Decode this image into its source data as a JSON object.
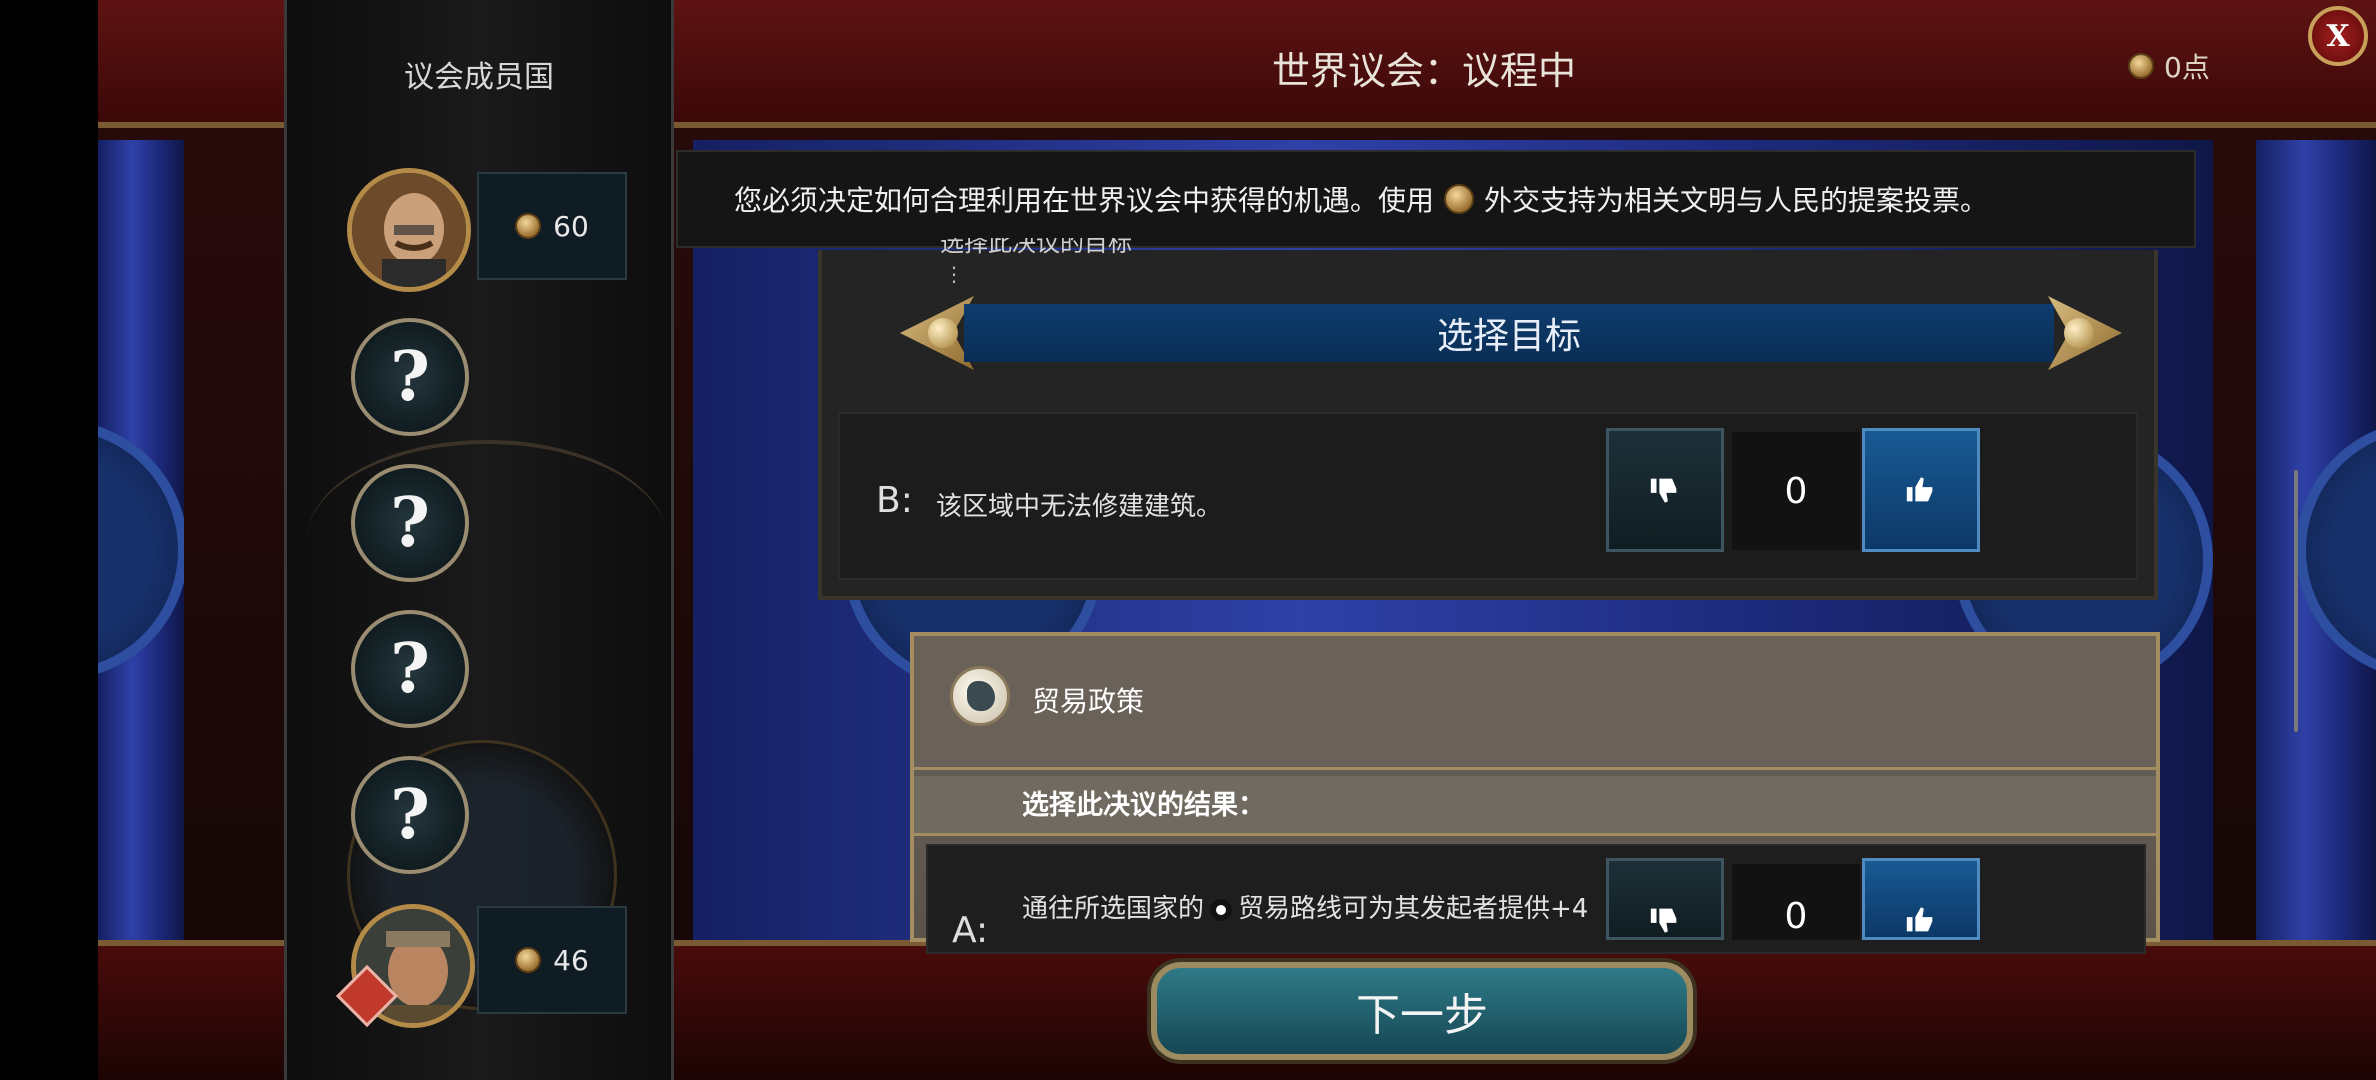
{
  "header": {
    "title": "世界议会：议程中",
    "points": "0点",
    "close_label": "X"
  },
  "sidebar": {
    "title": "议会成员国",
    "members": [
      {
        "type": "leader",
        "votes": "60"
      },
      {
        "type": "unknown",
        "symbol": "?"
      },
      {
        "type": "unknown",
        "symbol": "?"
      },
      {
        "type": "unknown",
        "symbol": "?"
      },
      {
        "type": "unknown",
        "symbol": "?"
      },
      {
        "type": "leader",
        "votes": "46"
      }
    ]
  },
  "info": {
    "text_before": "您必须决定如何合理利用在世界议会中获得的机遇。使用",
    "text_after": "外交支持为相关文明与人民的提案投票。"
  },
  "proposal1": {
    "partial_header": "选择此决议的目标",
    "target_button": "选择目标",
    "option_b": {
      "label": "B:",
      "text": "该区域中无法修建建筑。",
      "votes": "0"
    }
  },
  "proposal2": {
    "title": "贸易政策",
    "choose_outcome": "选择此决议的结果：",
    "option_a": {
      "label": "A:",
      "text_before": "通往所选国家的",
      "text_after": "贸易路线可为其发起者提供+4",
      "votes": "0"
    }
  },
  "footer": {
    "next_button": "下一步"
  },
  "icons": {
    "favor": "diplomatic-favor-icon",
    "thumbs_down": "thumbs-down-icon",
    "thumbs_up": "thumbs-up-icon",
    "globe": "globe-icon",
    "trade_route": "trade-route-icon",
    "close": "close-icon"
  },
  "colors": {
    "accent_gold": "#b48a48",
    "header_red": "#5e1313",
    "select_blue": "#0e3d6e",
    "vote_up_blue": "#185a94"
  }
}
